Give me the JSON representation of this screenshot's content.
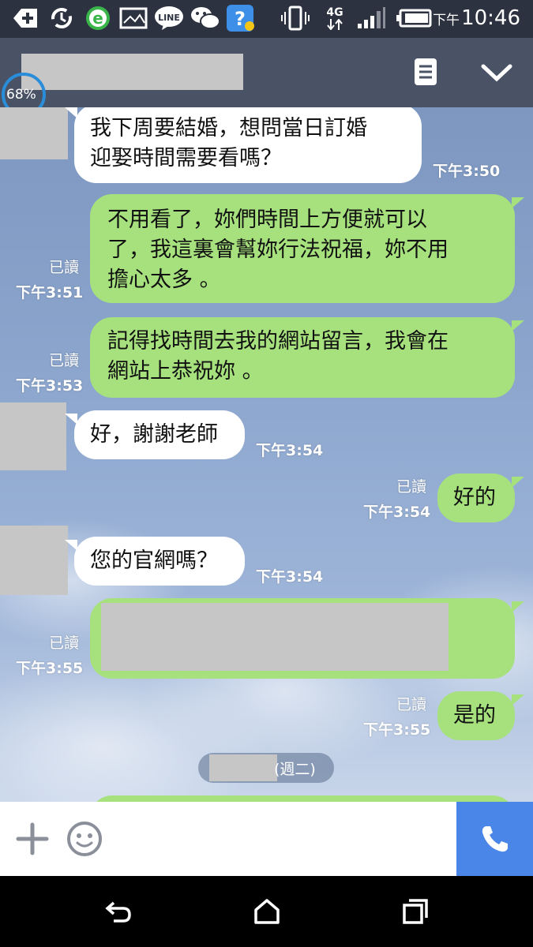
{
  "status_bar": {
    "network": "4G",
    "time_prefix": "下午",
    "time": "10:46",
    "icons": [
      "add-icon",
      "sync-icon",
      "browser-icon",
      "image-icon",
      "line-app-icon",
      "wechat-icon",
      "help-icon",
      "vibrate-icon",
      "signal-icon",
      "battery-icon"
    ],
    "line_label": "LINE"
  },
  "header": {
    "battery_overlay": "68%",
    "icons": [
      "notes-icon",
      "chevron-down-icon"
    ]
  },
  "messages": [
    {
      "dir": "in",
      "text": [
        "我下周要結婚，想問當日訂婚",
        "迎娶時間需要看嗎？"
      ],
      "time": "下午3:50"
    },
    {
      "dir": "out",
      "text": [
        "不用看了，妳們時間上方便就可以",
        "了，我這裏會幫妳行法祝福，妳不用",
        "擔心太多 。"
      ],
      "read": "已讀",
      "time": "下午3:51"
    },
    {
      "dir": "out",
      "text": [
        "記得找時間去我的網站留言，我會在",
        "網站上恭祝妳 。"
      ],
      "read": "已讀",
      "time": "下午3:53"
    },
    {
      "dir": "in",
      "text": [
        "好，謝謝老師"
      ],
      "time": "下午3:54"
    },
    {
      "dir": "out",
      "text": [
        "好的"
      ],
      "read": "已讀",
      "time": "下午3:54"
    },
    {
      "dir": "in",
      "text": [
        "您的官網嗎？"
      ],
      "time": "下午3:54"
    },
    {
      "dir": "out",
      "text": [],
      "read": "已讀",
      "time": "下午3:55"
    },
    {
      "dir": "out",
      "text": [
        "是的"
      ],
      "read": "已讀",
      "time": "下午3:55"
    }
  ],
  "date_separator": "(週二)",
  "colors": {
    "outgoing": "#a6e17e",
    "incoming": "#ffffff",
    "header": "#4a5366",
    "call_button": "#4a86e8"
  },
  "input_bar": {
    "icons": [
      "plus-icon",
      "emoji-icon",
      "phone-icon"
    ]
  },
  "nav_bar": {
    "icons": [
      "back-icon",
      "home-icon",
      "recent-apps-icon"
    ]
  }
}
